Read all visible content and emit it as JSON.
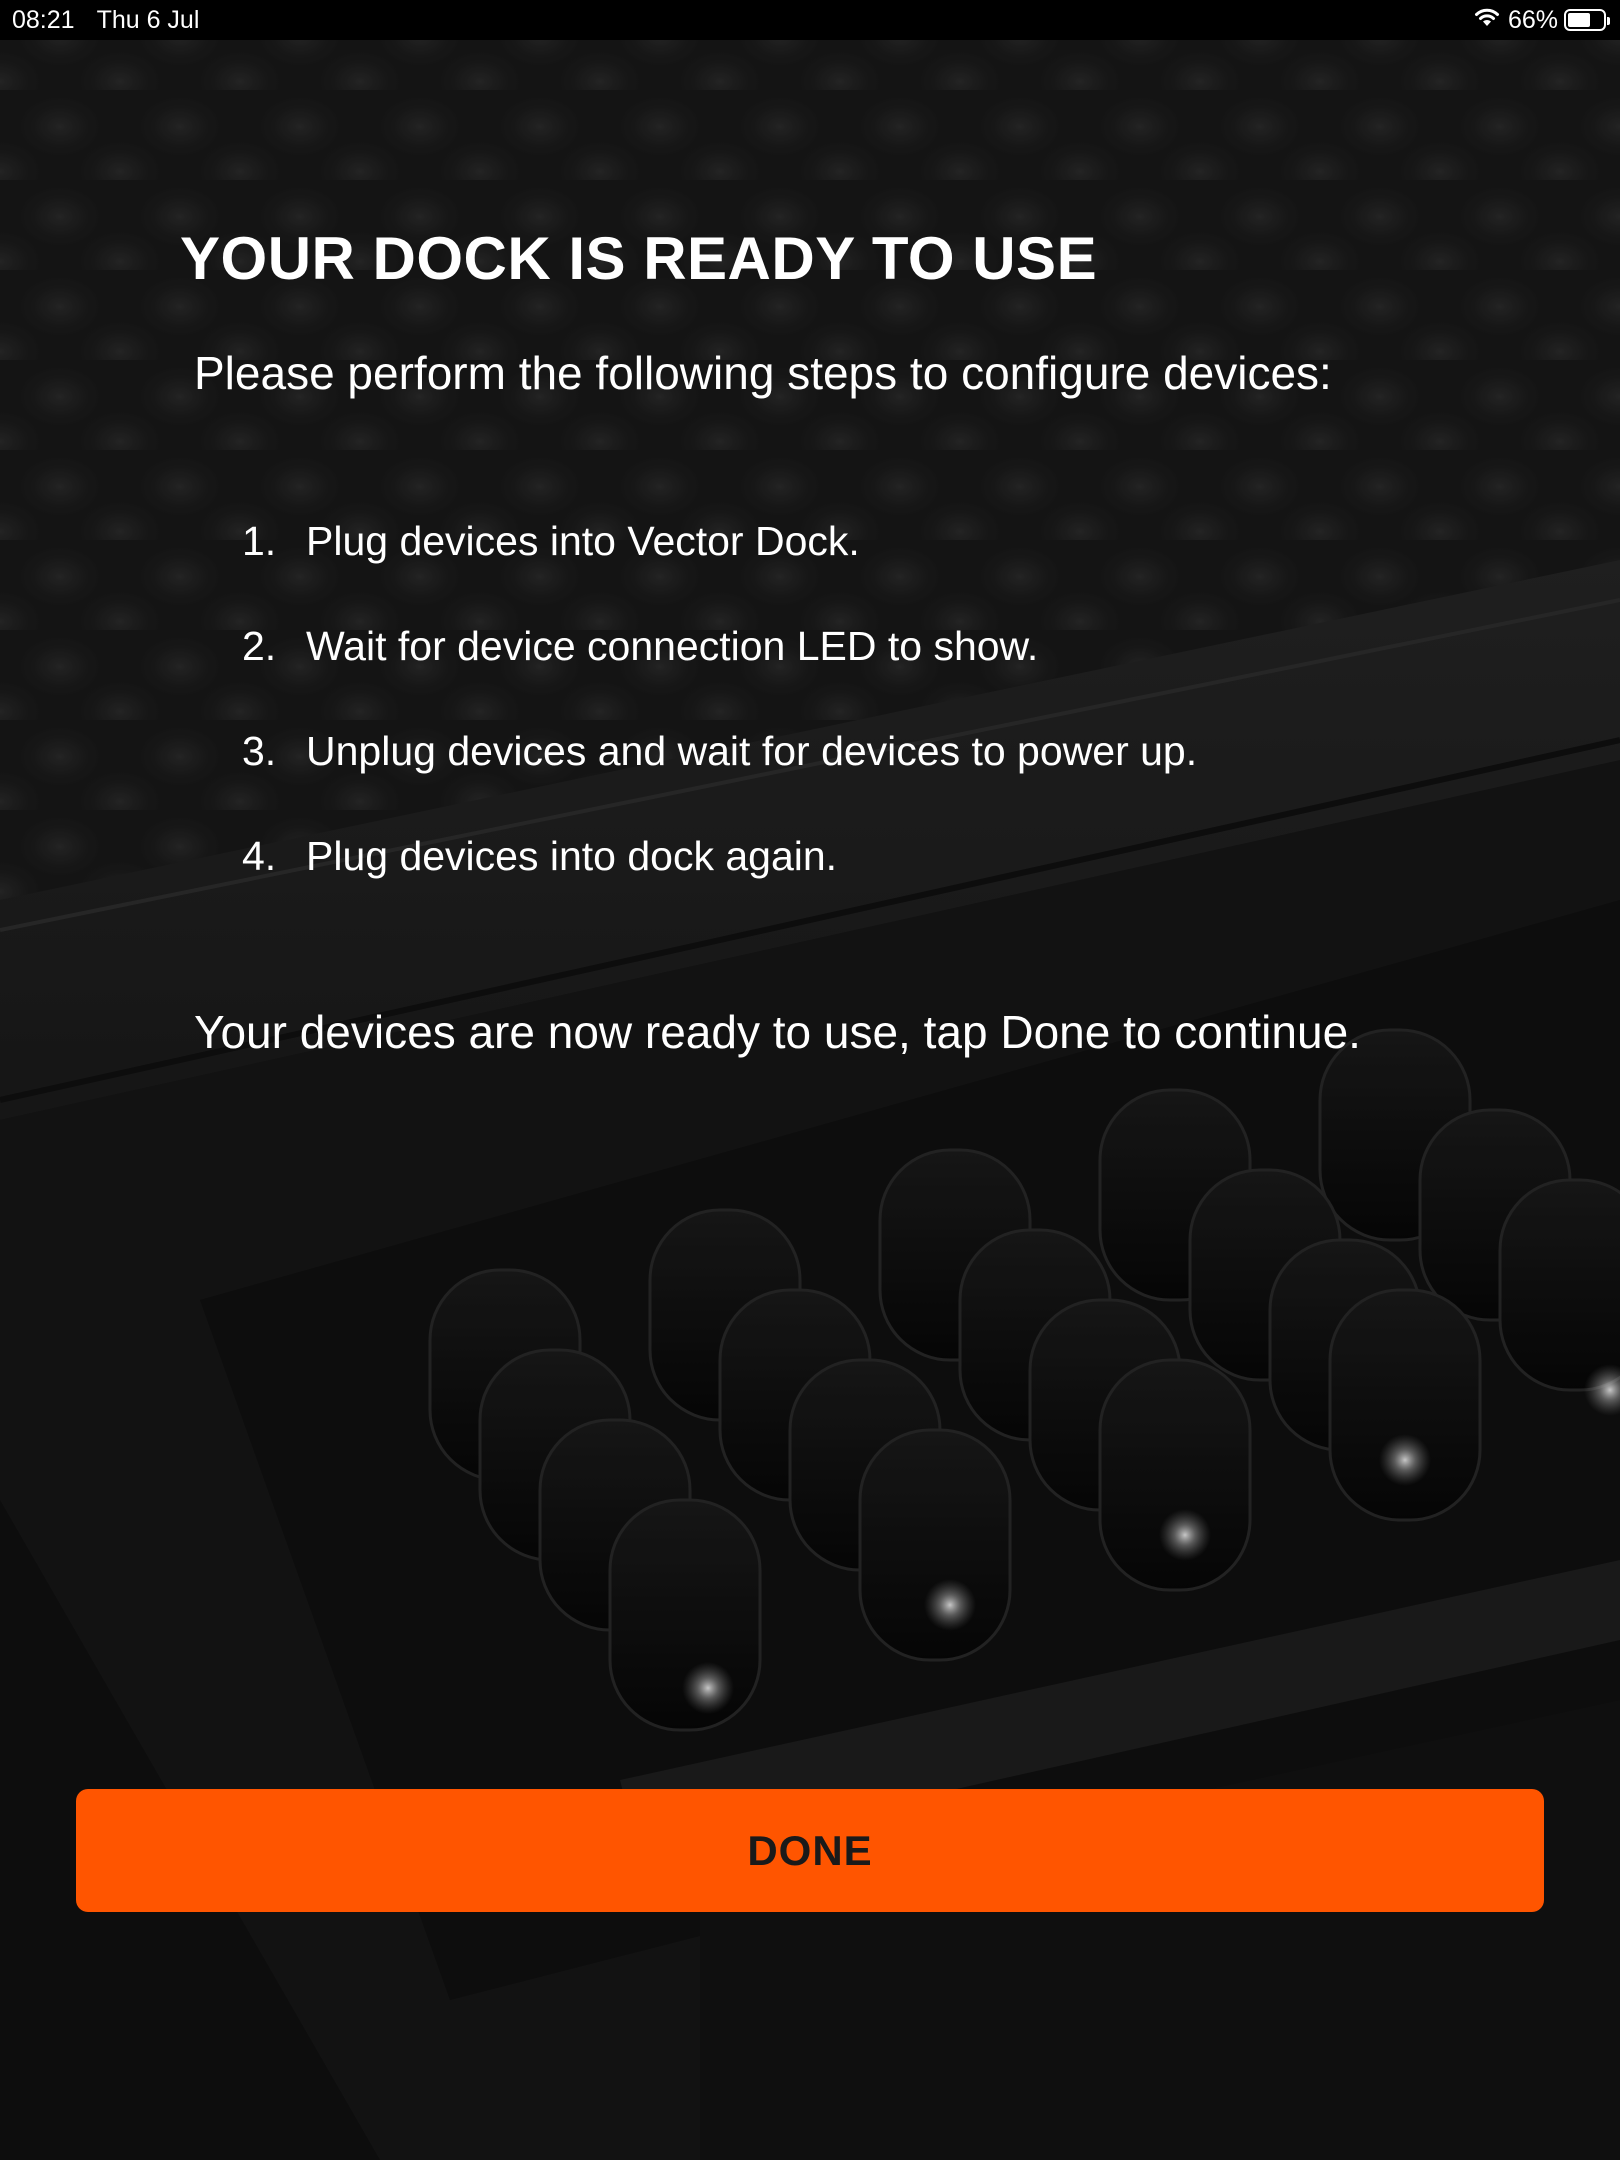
{
  "status_bar": {
    "time": "08:21",
    "date": "Thu 6 Jul",
    "battery_percent_label": "66%",
    "battery_level": 0.66,
    "icons": [
      "wifi-icon",
      "battery-icon"
    ]
  },
  "screen": {
    "title": "YOUR DOCK IS READY TO USE",
    "intro": "Please perform the following steps to configure devices:",
    "steps": [
      {
        "number": "1.",
        "text": "Plug devices into Vector Dock."
      },
      {
        "number": "2.",
        "text": "Wait for device connection LED to show."
      },
      {
        "number": "3.",
        "text": "Unplug devices and wait for devices to power up."
      },
      {
        "number": "4.",
        "text": "Plug devices into dock again."
      }
    ],
    "outro": "Your devices are now ready to use, tap Done to continue."
  },
  "actions": {
    "done_label": "DONE"
  },
  "colors": {
    "accent": "#ff5500",
    "background": "#151515",
    "status_bar": "#000000",
    "text": "#ffffff",
    "button_text": "#1a1a1a"
  }
}
